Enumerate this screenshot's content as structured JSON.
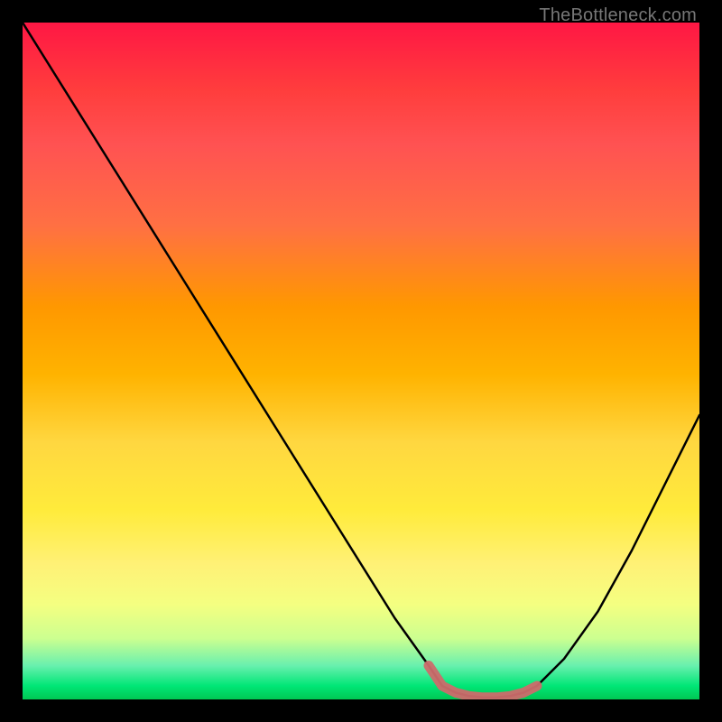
{
  "watermark": "TheBottleneck.com",
  "chart_data": {
    "type": "line",
    "title": "",
    "xlabel": "",
    "ylabel": "",
    "xlim": [
      0,
      100
    ],
    "ylim": [
      0,
      100
    ],
    "series": [
      {
        "name": "bottleneck-curve",
        "color": "#000000",
        "x": [
          0,
          5,
          10,
          15,
          20,
          25,
          30,
          35,
          40,
          45,
          50,
          55,
          60,
          62,
          64,
          66,
          68,
          70,
          72,
          74,
          76,
          80,
          85,
          90,
          95,
          100
        ],
        "values": [
          100,
          92,
          84,
          76,
          68,
          60,
          52,
          44,
          36,
          28,
          20,
          12,
          5,
          2,
          1,
          0.5,
          0.3,
          0.3,
          0.5,
          1,
          2,
          6,
          13,
          22,
          32,
          42
        ]
      },
      {
        "name": "highlight-band",
        "color": "#d07070",
        "x": [
          60,
          62,
          64,
          66,
          68,
          70,
          72,
          74,
          76
        ],
        "values": [
          5,
          2,
          1,
          0.5,
          0.3,
          0.3,
          0.5,
          1,
          2
        ]
      }
    ],
    "annotations": []
  }
}
